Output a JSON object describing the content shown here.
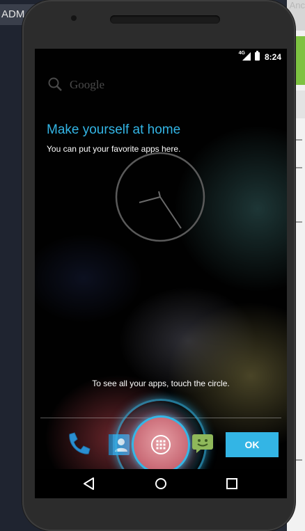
{
  "host": {
    "left_tab_label": "ADM",
    "right_ghost_text": "Anc"
  },
  "status_bar": {
    "network": "4G",
    "time": "8:24",
    "icons": [
      "signal-icon",
      "battery-icon"
    ]
  },
  "search": {
    "label": "Google",
    "icon": "search-icon"
  },
  "tip": {
    "title": "Make yourself at home",
    "text": "You can put your favorite apps here."
  },
  "clock_widget": {
    "icon": "analog-clock-widget"
  },
  "apps_hint": "To see all your apps, touch the circle.",
  "dock": {
    "items": [
      "phone-icon",
      "contacts-icon",
      "all-apps-icon",
      "messaging-icon"
    ]
  },
  "ok_button": {
    "label": "OK"
  },
  "nav_bar": {
    "buttons": [
      "back-icon",
      "home-icon",
      "recents-icon"
    ]
  },
  "colors": {
    "accent": "#33b5e5",
    "screen_background": "#000000",
    "phone_body": "#2c2c2c"
  }
}
